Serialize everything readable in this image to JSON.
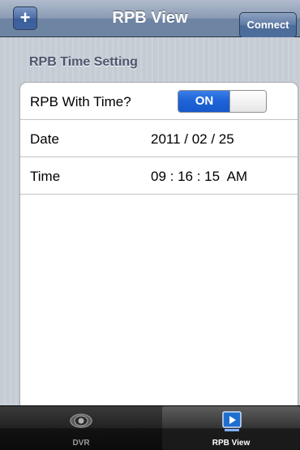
{
  "navbar": {
    "add_label": "+",
    "title": "RPB View",
    "connect_label": "Connect"
  },
  "section": {
    "header": "RPB Time Setting"
  },
  "rows": {
    "with_time": {
      "label": "RPB With Time?",
      "toggle_on_label": "ON",
      "toggle_state": "on"
    },
    "date": {
      "label": "Date",
      "value": "2011 / 02 / 25"
    },
    "time": {
      "label": "Time",
      "value": "09 : 16 : 15  AM"
    }
  },
  "tabbar": {
    "tabs": [
      {
        "label": "DVR",
        "icon": "eye-camera-icon",
        "selected": false
      },
      {
        "label": "RPB View",
        "icon": "play-monitor-icon",
        "selected": true
      }
    ]
  },
  "colors": {
    "toggle_on": "#1d63d7",
    "navbar": "#6d84a2",
    "background": "#c5ccd4"
  }
}
